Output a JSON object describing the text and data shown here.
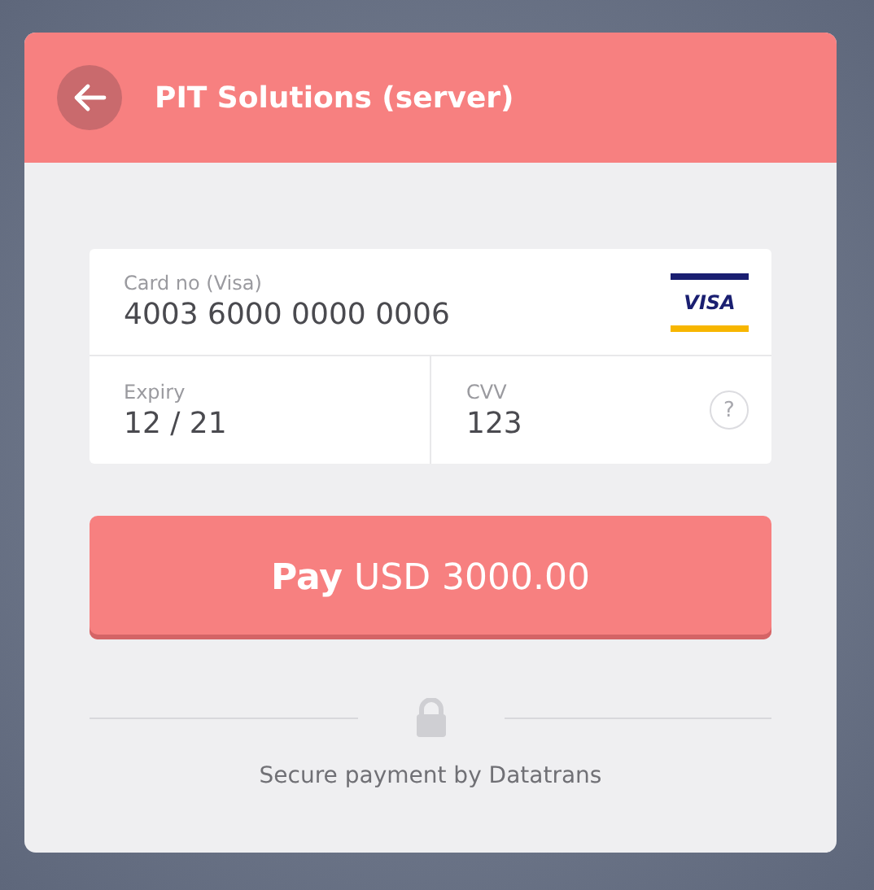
{
  "header": {
    "title": "PIT Solutions (server)"
  },
  "card_number": {
    "label": "Card no (Visa)",
    "value": "4003 6000 0000 0006",
    "brand": "VISA"
  },
  "expiry": {
    "label": "Expiry",
    "value": "12 / 21"
  },
  "cvv": {
    "label": "CVV",
    "value": "123",
    "help": "?"
  },
  "pay_button": "**Pay** USD 3000.00",
  "footer": "Secure payment by Datatrans"
}
